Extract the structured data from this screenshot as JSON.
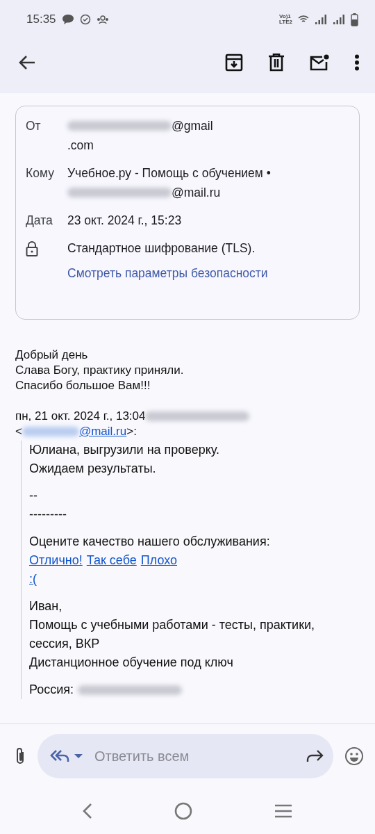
{
  "status_bar": {
    "time": "15:35",
    "network_label": [
      "Vo)1",
      "LTE2"
    ]
  },
  "header": {
    "rows": [
      {
        "label": "От",
        "lines": [
          [
            {
              "kind": "redacted"
            },
            {
              "kind": "text",
              "text": "@gmail"
            }
          ],
          [
            {
              "kind": "text",
              "text": ".com"
            }
          ]
        ]
      },
      {
        "label": "Кому",
        "lines": [
          [
            {
              "kind": "text",
              "text": "Учебное.ру - Помощь с обучением •"
            }
          ],
          [
            {
              "kind": "redacted"
            },
            {
              "kind": "text",
              "text": "@mail.ru"
            }
          ]
        ]
      },
      {
        "label": "Дата",
        "lines": [
          [
            {
              "kind": "text",
              "text": "23 окт. 2024 г., 15:23"
            }
          ]
        ]
      }
    ],
    "security": {
      "text": "Стандартное шифрование (TLS).",
      "link": "Смотреть параметры безопасности"
    }
  },
  "message": {
    "lines": [
      "Добрый день",
      "Слава Богу, практику приняли.",
      "Спасибо большое Вам!!!"
    ],
    "quote_header": [
      [
        {
          "kind": "text",
          "text": "пн, 21 окт. 2024 г., 13:04"
        },
        {
          "kind": "redacted"
        }
      ],
      [
        {
          "kind": "text",
          "text": "<"
        },
        {
          "kind": "redacted_link"
        },
        {
          "kind": "link",
          "text": "@mail.ru"
        },
        {
          "kind": "text",
          "text": ">:"
        }
      ]
    ],
    "quote": [
      {
        "kind": "lines",
        "lines": [
          [
            {
              "kind": "text",
              "text": "Юлиана, выгрузили на проверку."
            }
          ],
          [
            {
              "kind": "text",
              "text": "Ожидаем результаты."
            }
          ]
        ]
      },
      {
        "kind": "lines",
        "lines": [
          [
            {
              "kind": "text",
              "text": "--"
            }
          ],
          [
            {
              "kind": "text",
              "text": "---------"
            }
          ]
        ]
      },
      {
        "kind": "lines",
        "lines": [
          [
            {
              "kind": "text",
              "text": "Оцените качество нашего обслуживания:"
            }
          ],
          [
            {
              "kind": "link",
              "text": "Отлично!"
            },
            {
              "kind": "link",
              "text": "Так себе"
            },
            {
              "kind": "link",
              "text": "Плохо"
            }
          ],
          [
            {
              "kind": "link",
              "text": ":("
            }
          ]
        ]
      },
      {
        "kind": "lines",
        "lines": [
          [
            {
              "kind": "text",
              "text": "Иван,"
            }
          ],
          [
            {
              "kind": "text",
              "text": "Помощь с учебными работами - тесты, практики, сессия, ВКР"
            }
          ],
          [
            {
              "kind": "text",
              "text": "Дистанционное обучение под ключ"
            }
          ]
        ]
      },
      {
        "kind": "lines",
        "lines": [
          [
            {
              "kind": "text",
              "text": "Россия:"
            },
            {
              "kind": "redacted"
            }
          ]
        ]
      }
    ]
  },
  "reply_bar": {
    "placeholder": "Ответить всем"
  }
}
